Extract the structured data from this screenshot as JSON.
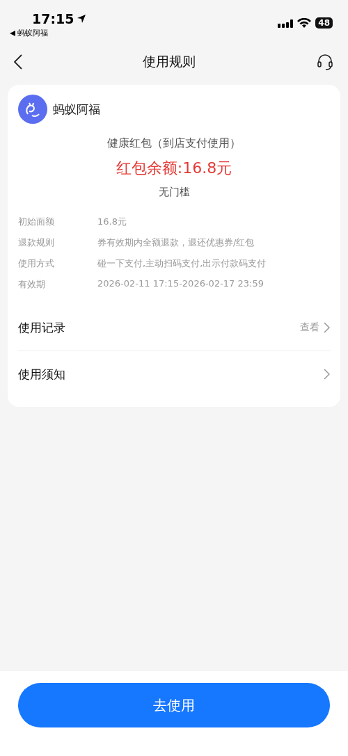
{
  "status_bar": {
    "time": "17:15",
    "back_app": "蚂蚁阿福",
    "battery": "48"
  },
  "nav": {
    "title": "使用规则"
  },
  "card": {
    "brand": "蚂蚁阿福",
    "name": "健康红包（到店支付使用）",
    "balance": "红包余额:16.8元",
    "threshold": "无门槛",
    "details": [
      {
        "label": "初始面额",
        "value": "16.8元"
      },
      {
        "label": "退款规则",
        "value": "券有效期内全额退款，退还优惠券/红包"
      },
      {
        "label": "使用方式",
        "value": "碰一下支付,主动扫码支付,出示付款码支付"
      },
      {
        "label": "有效期",
        "value": "2026-02-11 17:15-2026-02-17 23:59"
      }
    ],
    "links": [
      {
        "label": "使用记录",
        "action": "查看"
      },
      {
        "label": "使用须知"
      }
    ]
  },
  "primary_button": "去使用"
}
